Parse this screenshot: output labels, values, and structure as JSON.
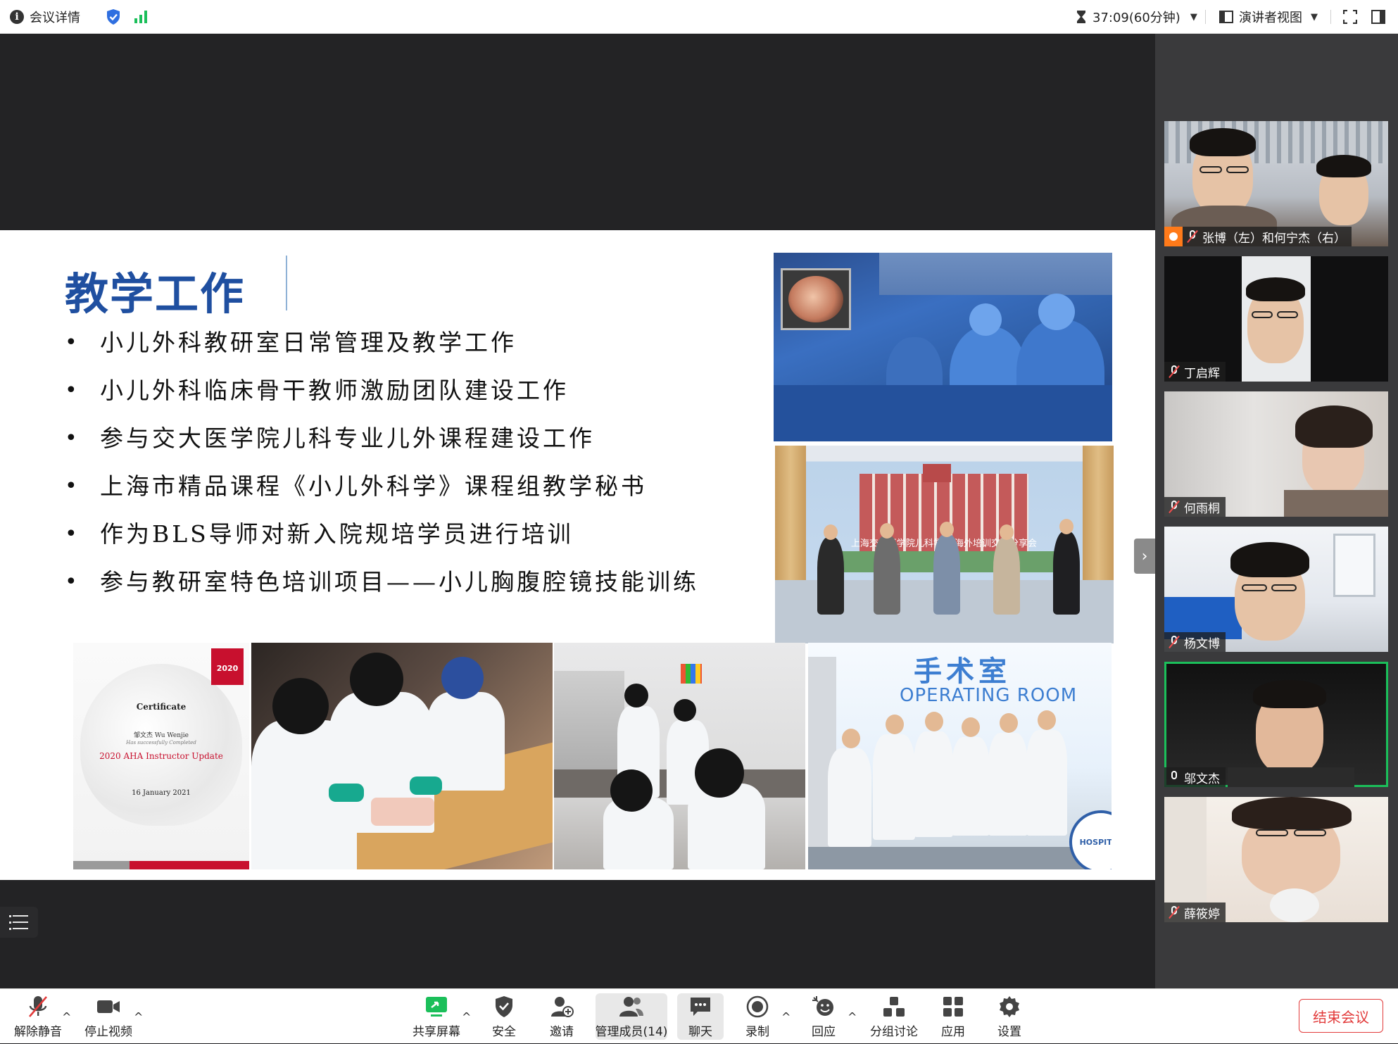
{
  "topbar": {
    "meeting_info_label": "会议详情",
    "timer_text": "37:09(60分钟)",
    "view_mode_label": "演讲者视图"
  },
  "slide": {
    "title": "教学工作",
    "bullets": [
      "小儿外科教研室日常管理及教学工作",
      "小儿外科临床骨干教师激励团队建设工作",
      "参与交大医学院儿科专业儿外课程建设工作",
      "上海市精品课程《小儿外科学》课程组教学秘书",
      "作为BLS导师对新入院规培学员进行培训",
      "参与教研室特色培训项目——小儿胸腹腔镜技能训练"
    ],
    "certificate": {
      "logo_text": "2020",
      "heading": "Certificate",
      "name": "邹文杰 Wu Wenjie",
      "completed": "Has successfully Completed",
      "course": "2020 AHA Instructor Update",
      "date": "16 January 2021"
    },
    "group_banner": "上海交大医学院儿科学院 海外培训交流分享会",
    "or_sign": {
      "cn": "手术室",
      "en": "OPERATING ROOM"
    },
    "hospital_badge": "HOSPITAL"
  },
  "participants": [
    {
      "name": "张博（左）和何宁杰（右）",
      "muted": true,
      "host": true,
      "active": false
    },
    {
      "name": "丁启辉",
      "muted": true,
      "host": false,
      "active": false
    },
    {
      "name": "何雨桐",
      "muted": true,
      "host": false,
      "active": false
    },
    {
      "name": "杨文博",
      "muted": true,
      "host": false,
      "active": false
    },
    {
      "name": "邬文杰",
      "muted": false,
      "host": false,
      "active": true
    },
    {
      "name": "薛筱婷",
      "muted": true,
      "host": false,
      "active": false
    }
  ],
  "toolbar": {
    "unmute_label": "解除静音",
    "stop_video_label": "停止视频",
    "share_screen_label": "共享屏幕",
    "security_label": "安全",
    "invite_label": "邀请",
    "manage_members_label": "管理成员(14)",
    "chat_label": "聊天",
    "record_label": "录制",
    "reactions_label": "回应",
    "breakout_label": "分组讨论",
    "apps_label": "应用",
    "settings_label": "设置",
    "end_meeting_label": "结束会议"
  },
  "colors": {
    "accent_green": "#1bbf5a",
    "end_red": "#e23b3b",
    "title_blue": "#1f4fa0",
    "shield_blue": "#2f6fe0"
  }
}
